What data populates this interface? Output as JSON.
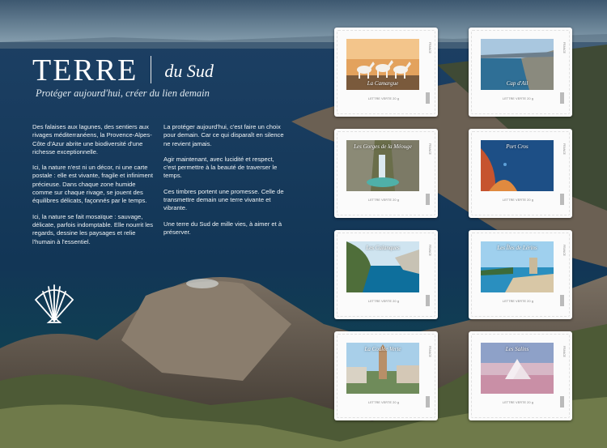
{
  "title": {
    "main": "TERRE",
    "sub": "du Sud"
  },
  "tagline": "Protéger aujourd'hui, créer du lien demain",
  "column_left": [
    "Des falaises aux lagunes, des sentiers aux rivages méditerranéens, la Provence-Alpes-Côte d'Azur abrite une biodiversité d'une richesse exceptionnelle.",
    "Ici, la nature n'est ni un décor, ni une carte postale : elle est vivante, fragile et infiniment précieuse. Dans chaque zone humide comme sur chaque rivage, se jouent des équilibres délicats, façonnés par le temps.",
    "Ici, la nature se fait mosaïque : sauvage, délicate, parfois indomptable. Elle nourrit les regards, dessine les paysages et relie l'humain à l'essentiel."
  ],
  "column_right": [
    "La protéger aujourd'hui, c'est faire un choix pour demain. Car ce qui disparaît en silence ne revient jamais.",
    "Agir maintenant, avec lucidité et respect, c'est permettre à la beauté de traverser le temps.",
    "Ces timbres portent une promesse. Celle de transmettre demain une terre vivante et vibrante.",
    "Une terre du Sud de mille vies, à aimer et à préserver."
  ],
  "stamp_value_text": "LETTRE VERTE 20 g",
  "stamp_side_text": "FRANCE",
  "stamps": [
    {
      "name": "La Camargue",
      "label_pos": "bottom",
      "scene": "camargue"
    },
    {
      "name": "Cap d'Ail",
      "label_pos": "bottom",
      "scene": "capdail"
    },
    {
      "name": "Les Gorges de la Méouge",
      "label_pos": "top",
      "scene": "gorges"
    },
    {
      "name": "Port Cros",
      "label_pos": "top",
      "scene": "portcros"
    },
    {
      "name": "Les Calanques",
      "label_pos": "top",
      "scene": "calanques"
    },
    {
      "name": "Les Îles de Lérins",
      "label_pos": "top",
      "scene": "lerins"
    },
    {
      "name": "La Coulée Verte",
      "label_pos": "top",
      "scene": "couleeverte"
    },
    {
      "name": "Les Salins",
      "label_pos": "top",
      "scene": "salins"
    }
  ]
}
